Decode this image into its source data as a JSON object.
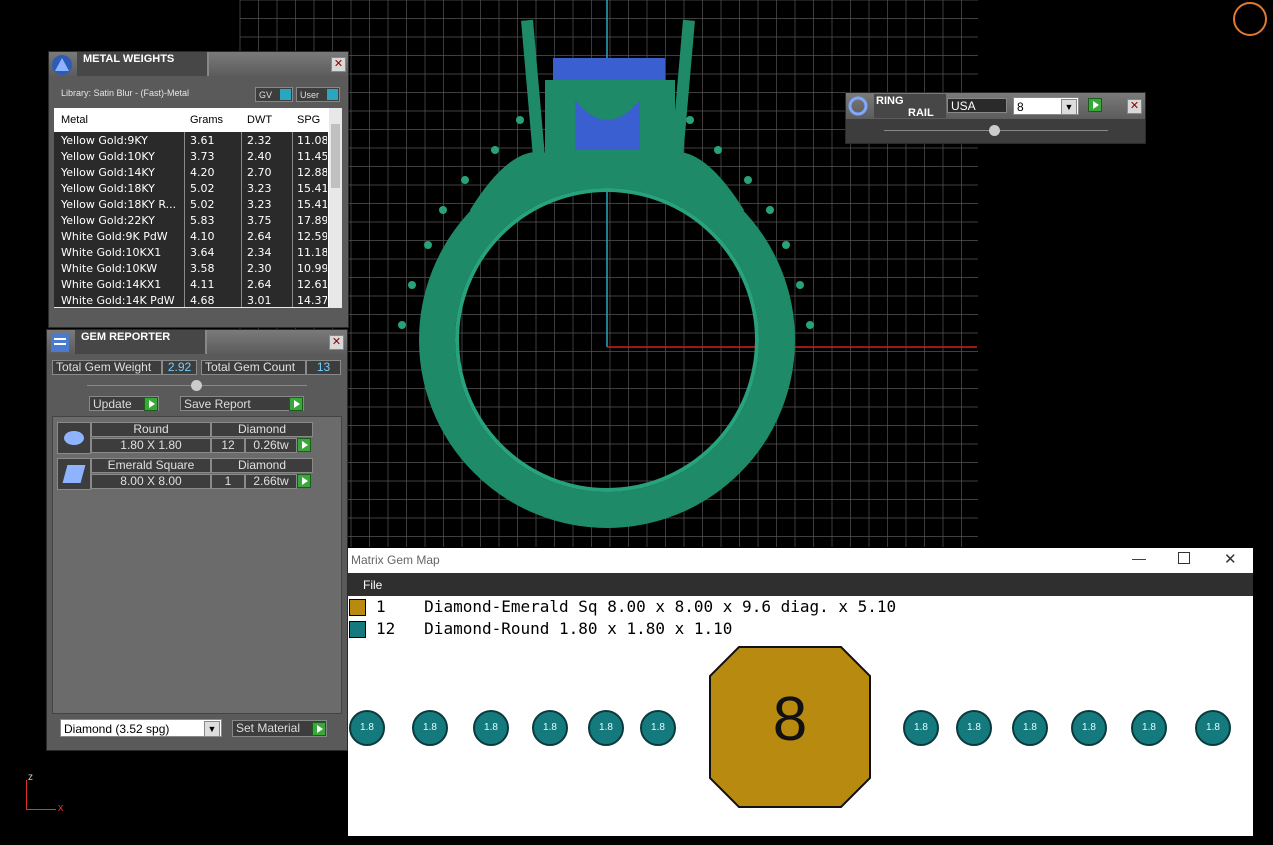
{
  "metal_weights": {
    "title": "METAL WEIGHTS",
    "library": "Library: Satin Blur - (Fast)-Metal",
    "toggle_gv": "GV",
    "toggle_user": "User",
    "columns": [
      "Metal",
      "Grams",
      "DWT",
      "SPG"
    ],
    "rows": [
      [
        "Yellow Gold:9KY",
        "3.61",
        "2.32",
        "11.08"
      ],
      [
        "Yellow Gold:10KY",
        "3.73",
        "2.40",
        "11.45"
      ],
      [
        "Yellow Gold:14KY",
        "4.20",
        "2.70",
        "12.88"
      ],
      [
        "Yellow Gold:18KY",
        "5.02",
        "3.23",
        "15.41"
      ],
      [
        "Yellow Gold:18KY R...",
        "5.02",
        "3.23",
        "15.41"
      ],
      [
        "Yellow Gold:22KY",
        "5.83",
        "3.75",
        "17.89"
      ],
      [
        "White Gold:9K PdW",
        "4.10",
        "2.64",
        "12.59"
      ],
      [
        "White Gold:10KX1",
        "3.64",
        "2.34",
        "11.18"
      ],
      [
        "White Gold:10KW",
        "3.58",
        "2.30",
        "10.99"
      ],
      [
        "White Gold:14KX1",
        "4.11",
        "2.64",
        "12.61"
      ],
      [
        "White Gold:14K PdW",
        "4.68",
        "3.01",
        "14.37"
      ]
    ]
  },
  "gem_reporter": {
    "title": "GEM REPORTER",
    "total_weight_label": "Total Gem Weight",
    "total_weight_value": "2.92",
    "total_count_label": "Total Gem Count",
    "total_count_value": "13",
    "update_label": "Update",
    "save_label": "Save Report",
    "gems": [
      {
        "shape": "Round",
        "material": "Diamond",
        "size": "1.80 X 1.80",
        "count": "12",
        "weight": "0.26tw"
      },
      {
        "shape": "Emerald Square",
        "material": "Diamond",
        "size": "8.00 X 8.00",
        "count": "1",
        "weight": "2.66tw"
      }
    ],
    "material_select": "Diamond     (3.52 spg)",
    "set_material_label": "Set Material"
  },
  "ring_rail": {
    "title_line1": "RING",
    "title_line2": "RAIL",
    "region": "USA",
    "size": "8"
  },
  "gem_map": {
    "window_title": "Matrix Gem Map",
    "menu_file": "File",
    "legend": [
      {
        "count": "1",
        "desc": "Diamond-Emerald Sq 8.00 x 8.00 x 9.6 diag. x 5.10",
        "color": "#b98a10"
      },
      {
        "count": "12",
        "desc": "Diamond-Round 1.80 x 1.80 x 1.10",
        "color": "#157a7e"
      }
    ],
    "center_label": "8",
    "round_label": "1.8"
  },
  "axes": {
    "z": "z",
    "x": "x"
  },
  "colors": {
    "ring": "#1e8a68",
    "stone": "#3a5fd0",
    "grid": "#5a5a5a",
    "axis_red": "#d32020",
    "axis_cyan": "#2aa7c0"
  }
}
